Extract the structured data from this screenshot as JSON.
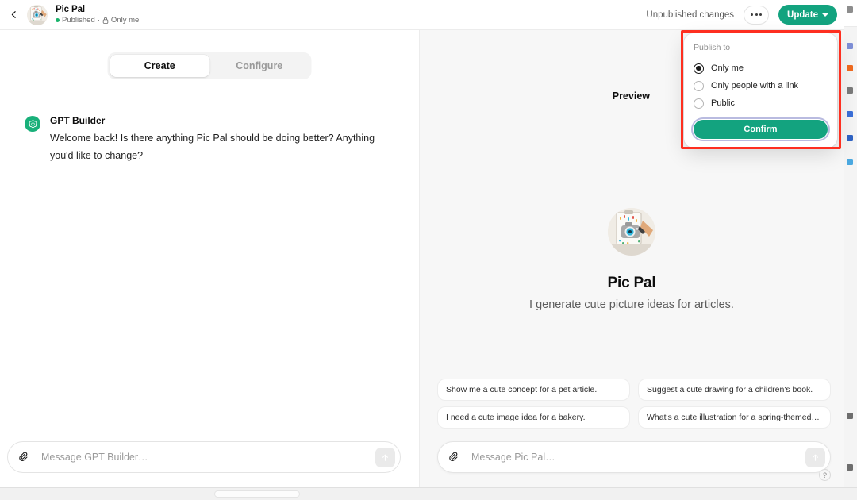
{
  "header": {
    "back_icon": "chevron-left-icon",
    "avatar_icon": "gpt-avatar-image",
    "title": "Pic Pal",
    "status": "Published",
    "separator": "·",
    "lock_icon": "lock-icon",
    "visibility": "Only me",
    "unpublished_changes": "Unpublished changes",
    "more_label": "More options",
    "update_label": "Update",
    "update_color": "#13a37f"
  },
  "left_pane": {
    "tabs": [
      {
        "label": "Create",
        "active": true
      },
      {
        "label": "Configure",
        "active": false
      }
    ],
    "message": {
      "avatar_icon": "openai-logo-icon",
      "author": "GPT Builder",
      "text": "Welcome back! Is there anything Pic Pal should be doing better? Anything you'd like to change?"
    },
    "composer": {
      "attach_icon": "paperclip-icon",
      "placeholder": "Message GPT Builder…",
      "value": "",
      "send_icon": "arrow-up-icon"
    }
  },
  "right_pane": {
    "preview_label": "Preview",
    "gpt": {
      "avatar_icon": "gpt-avatar-image",
      "name": "Pic Pal",
      "description": "I generate cute picture ideas for articles."
    },
    "suggestions": [
      "Show me a cute concept for a pet article.",
      "Suggest a cute drawing for a children's book.",
      "I need a cute image idea for a bakery.",
      "What's a cute illustration for a spring-themed…"
    ],
    "composer": {
      "attach_icon": "paperclip-icon",
      "placeholder": "Message Pic Pal…",
      "value": "",
      "send_icon": "arrow-up-icon"
    },
    "help_label": "?"
  },
  "publish_popover": {
    "title": "Publish to",
    "options": [
      {
        "label": "Only me",
        "selected": true
      },
      {
        "label": "Only people with a link",
        "selected": false
      },
      {
        "label": "Public",
        "selected": false
      }
    ],
    "confirm_label": "Confirm",
    "confirm_color": "#13a37f",
    "focus_ring_color": "#b9bbe0",
    "highlight_color": "#fe2f20"
  }
}
